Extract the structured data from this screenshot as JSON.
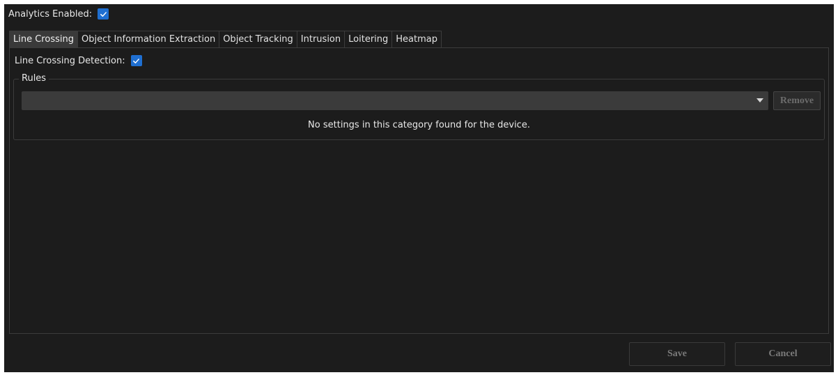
{
  "analytics": {
    "label": "Analytics Enabled:",
    "checked": true
  },
  "tabs": [
    {
      "label": "Line Crossing",
      "active": true
    },
    {
      "label": "Object Information Extraction",
      "active": false
    },
    {
      "label": "Object Tracking",
      "active": false
    },
    {
      "label": "Intrusion",
      "active": false
    },
    {
      "label": "Loitering",
      "active": false
    },
    {
      "label": "Heatmap",
      "active": false
    }
  ],
  "line_crossing": {
    "detection_label": "Line Crossing Detection:",
    "detection_checked": true,
    "rules": {
      "legend": "Rules",
      "selected_value": "",
      "remove_label": "Remove",
      "empty_message": "No settings in this category found for the device."
    }
  },
  "footer": {
    "save_label": "Save",
    "cancel_label": "Cancel"
  },
  "colors": {
    "background": "#1c1c1c",
    "accent": "#1f6fd1",
    "active_tab": "#3a3a3a"
  }
}
